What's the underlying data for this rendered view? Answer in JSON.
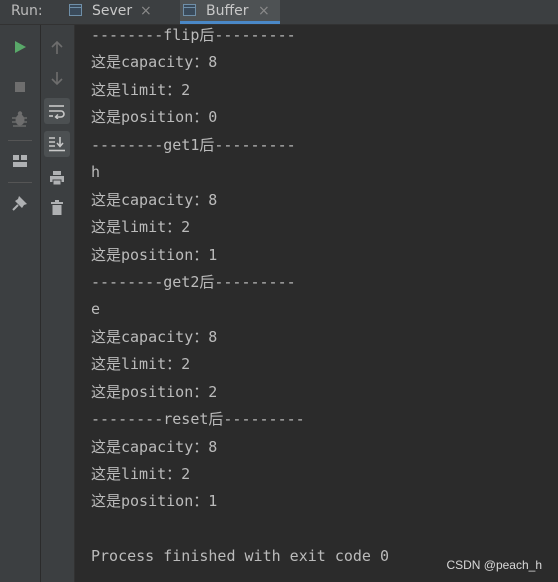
{
  "run_bar": {
    "label": "Run:",
    "tabs": [
      {
        "label": "Sever",
        "close": "×"
      },
      {
        "label": "Buffer",
        "close": "×"
      }
    ]
  },
  "console": {
    "lines": [
      "--------flip后---------",
      "这是capacity：8",
      "这是limit：2",
      "这是position：0",
      "--------get1后---------",
      "h",
      "这是capacity：8",
      "这是limit：2",
      "这是position：1",
      "--------get2后---------",
      "e",
      "这是capacity：8",
      "这是limit：2",
      "这是position：2",
      "--------reset后---------",
      "这是capacity：8",
      "这是limit：2",
      "这是position：1",
      "",
      "Process finished with exit code 0"
    ]
  },
  "watermark": "CSDN @peach_h",
  "toolbar_icons": {
    "left": [
      "run-icon",
      "stop-icon",
      "debug-icon",
      "layout-icon",
      "pin-icon"
    ],
    "right": [
      "up-arrow-icon",
      "down-arrow-icon",
      "soft-wrap-icon",
      "scroll-to-end-icon",
      "print-icon",
      "trash-icon"
    ]
  },
  "colors": {
    "background": "#2b2b2b",
    "toolbar": "#3c3f41",
    "text": "#bbbbbb",
    "run_green": "#59a869",
    "active_tab_underline": "#4a88c7"
  }
}
